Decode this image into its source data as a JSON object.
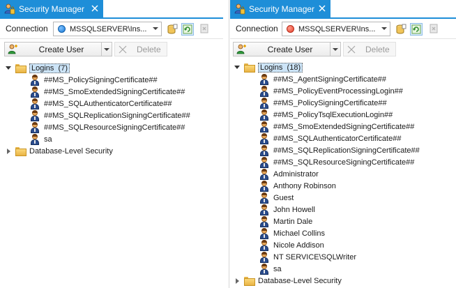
{
  "left": {
    "tab_title": "Security Manager",
    "connection_label": "Connection",
    "connection_value": "MSSQLSERVER\\Ins...",
    "connection_status_color": "#1877d6",
    "create_user_label": "Create User",
    "delete_label": "Delete",
    "logins_label": "Logins",
    "logins_count": "(7)",
    "logins": [
      "##MS_PolicySigningCertificate##",
      "##MS_SmoExtendedSigningCertificate##",
      "##MS_SQLAuthenticatorCertificate##",
      "##MS_SQLReplicationSigningCertificate##",
      "##MS_SQLResourceSigningCertificate##",
      "sa"
    ],
    "db_security_label": "Database-Level Security"
  },
  "right": {
    "tab_title": "Security Manager",
    "connection_label": "Connection",
    "connection_value": "MSSQLSERVER\\Ins...",
    "connection_status_color": "#e6402b",
    "create_user_label": "Create User",
    "delete_label": "Delete",
    "logins_label": "Logins",
    "logins_count": "(18)",
    "logins": [
      "##MS_AgentSigningCertificate##",
      "##MS_PolicyEventProcessingLogin##",
      "##MS_PolicySigningCertificate##",
      "##MS_PolicyTsqlExecutionLogin##",
      "##MS_SmoExtendedSigningCertificate##",
      "##MS_SQLAuthenticatorCertificate##",
      "##MS_SQLReplicationSigningCertificate##",
      "##MS_SQLResourceSigningCertificate##",
      "Administrator",
      "Anthony Robinson",
      "Guest",
      "John Howell",
      "Martin Dale",
      "Michael Collins",
      "Nicole Addison",
      "NT SERVICE\\SQLWriter",
      "sa"
    ],
    "db_security_label": "Database-Level Security"
  },
  "icons": {
    "tab_icon": "security-manager-icon",
    "close": "close-icon",
    "open_db": "database-open-icon",
    "refresh": "refresh-icon",
    "disconnect": "disconnect-icon",
    "create_user": "add-user-icon",
    "delete": "delete-icon",
    "folder": "folder-icon",
    "user": "user-icon"
  }
}
